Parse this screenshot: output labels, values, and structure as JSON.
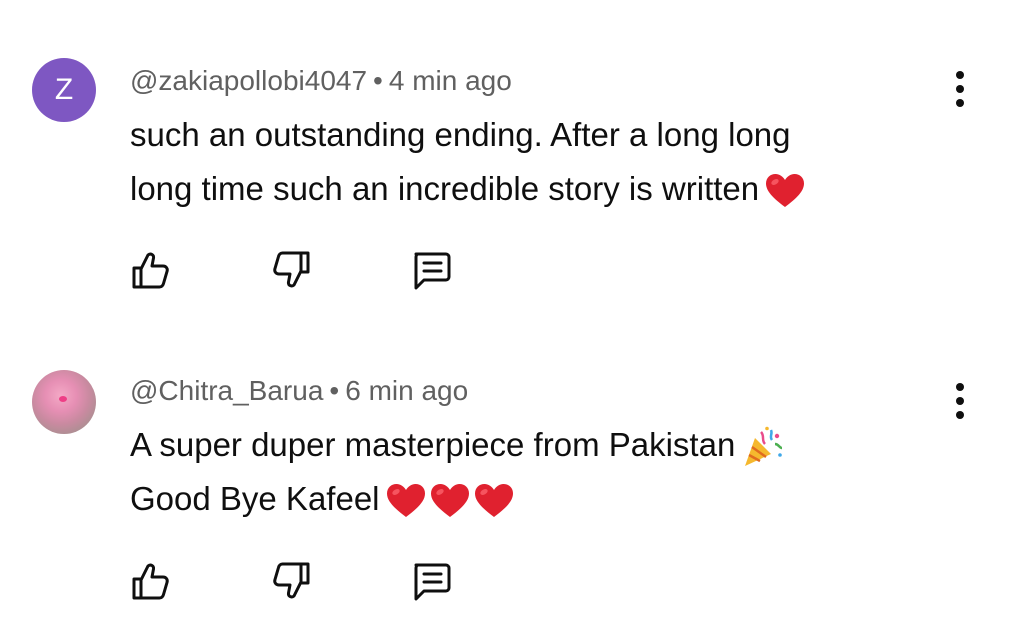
{
  "comments": [
    {
      "avatar_letter": "Z",
      "avatar_color": "#7e57c2",
      "username": "@zakiapollobi4047",
      "separator": "•",
      "time": "4 min ago",
      "text_lines": [
        "such an outstanding ending. After a long long",
        "long time such an incredible story is written"
      ],
      "emoji": [
        "red-heart"
      ]
    },
    {
      "avatar_type": "photo",
      "username": "@Chitra_Barua",
      "separator": "•",
      "time": "6 min ago",
      "text_lines": [
        "A super duper masterpiece from Pakistan",
        "Good Bye Kafeel"
      ],
      "emoji": [
        "party-popper",
        "red-heart",
        "red-heart",
        "red-heart"
      ]
    }
  ],
  "icons": {
    "like": "thumbs-up-icon",
    "dislike": "thumbs-down-icon",
    "reply": "reply-comment-icon",
    "menu": "more-vert-icon"
  },
  "colors": {
    "text_primary": "#0f0f0f",
    "text_secondary": "#606060",
    "heart": "#e0212f"
  }
}
